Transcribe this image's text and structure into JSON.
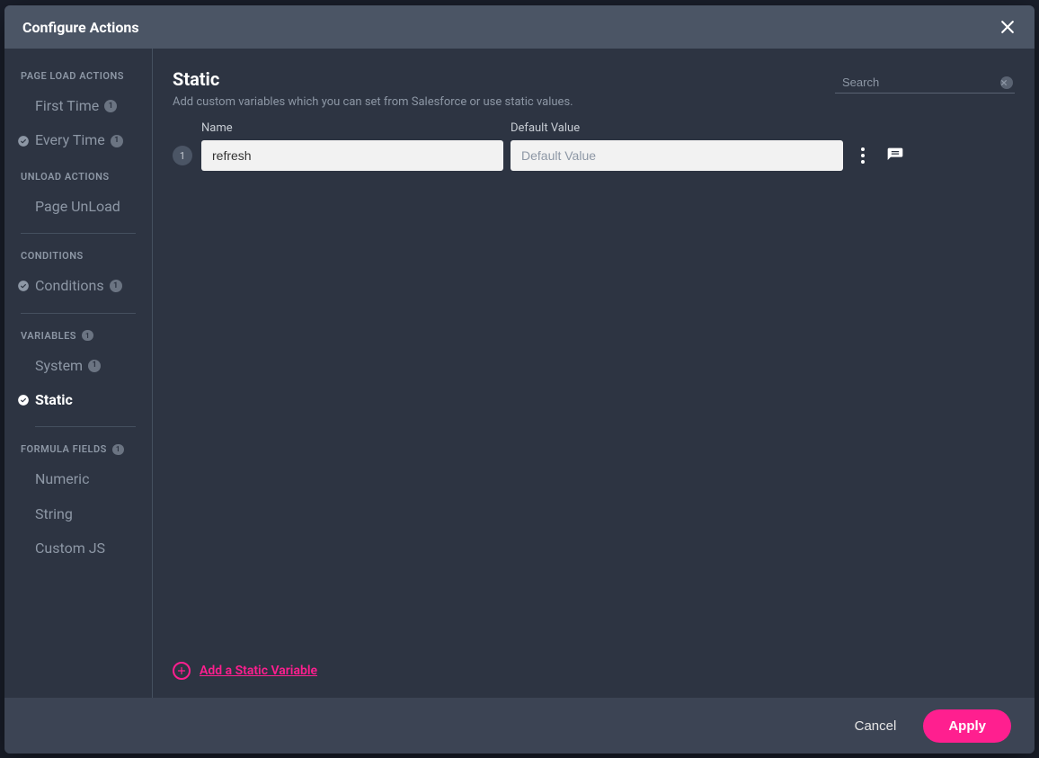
{
  "header": {
    "title": "Configure Actions"
  },
  "sidebar": {
    "sections": {
      "page_load_actions": {
        "label": "PAGE LOAD ACTIONS"
      },
      "unload_actions": {
        "label": "UNLOAD ACTIONS"
      },
      "conditions": {
        "label": "CONDITIONS"
      },
      "variables": {
        "label": "VARIABLES",
        "badge": "1"
      },
      "formula_fields": {
        "label": "FORMULA FIELDS",
        "badge": "1"
      }
    },
    "items": {
      "first_time": {
        "label": "First Time",
        "badge": "1"
      },
      "every_time": {
        "label": "Every Time",
        "badge": "1"
      },
      "page_unload": {
        "label": "Page UnLoad"
      },
      "conditions": {
        "label": "Conditions",
        "badge": "1"
      },
      "system": {
        "label": "System",
        "badge": "1"
      },
      "static": {
        "label": "Static"
      },
      "numeric": {
        "label": "Numeric"
      },
      "string": {
        "label": "String"
      },
      "custom_js": {
        "label": "Custom JS"
      }
    }
  },
  "main": {
    "title": "Static",
    "subtitle": "Add custom variables which you can set from Salesforce or use static values.",
    "search_placeholder": "Search",
    "columns": {
      "name": "Name",
      "default_value": "Default Value"
    },
    "rows": [
      {
        "num": "1",
        "name": "refresh",
        "default_value": "",
        "default_placeholder": "Default Value"
      }
    ],
    "add_label": "Add a Static Variable"
  },
  "footer": {
    "cancel": "Cancel",
    "apply": "Apply"
  }
}
